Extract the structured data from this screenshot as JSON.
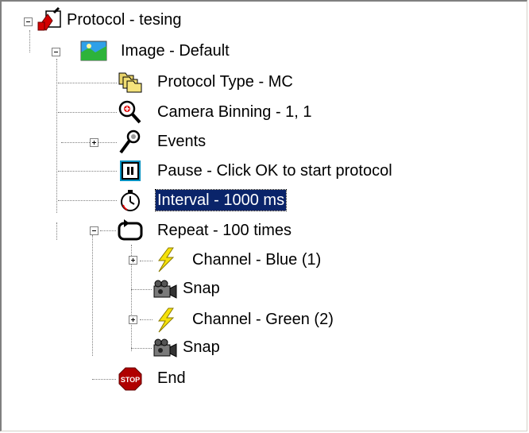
{
  "tree": {
    "nodes": [
      {
        "label": "Protocol - tesing",
        "icon": "protocol-icon",
        "expander": "minus"
      },
      {
        "label": "Image - Default",
        "icon": "image-icon",
        "expander": "minus"
      },
      {
        "label": "Protocol Type - MC",
        "icon": "folders-icon"
      },
      {
        "label": "Camera Binning - 1, 1",
        "icon": "magnifier-icon"
      },
      {
        "label": "Events",
        "icon": "events-icon",
        "expander": "plus"
      },
      {
        "label": "Pause - Click OK to start protocol",
        "icon": "pause-icon"
      },
      {
        "label": "Interval - 1000 ms",
        "icon": "stopwatch-icon",
        "selected": true
      },
      {
        "label": "Repeat - 100 times",
        "icon": "repeat-icon",
        "expander": "minus"
      },
      {
        "label": "Channel - Blue (1)",
        "icon": "lightning-icon",
        "expander": "plus"
      },
      {
        "label": "Snap",
        "icon": "camera-icon"
      },
      {
        "label": "Channel - Green (2)",
        "icon": "lightning-icon",
        "expander": "plus"
      },
      {
        "label": "Snap",
        "icon": "camera-icon"
      },
      {
        "label": "End",
        "icon": "stop-icon"
      }
    ]
  },
  "colors": {
    "selection": "#0a246a",
    "tree_lines": "#808080",
    "stop_sign": "#b00000",
    "lightning": "#f5e10a"
  }
}
